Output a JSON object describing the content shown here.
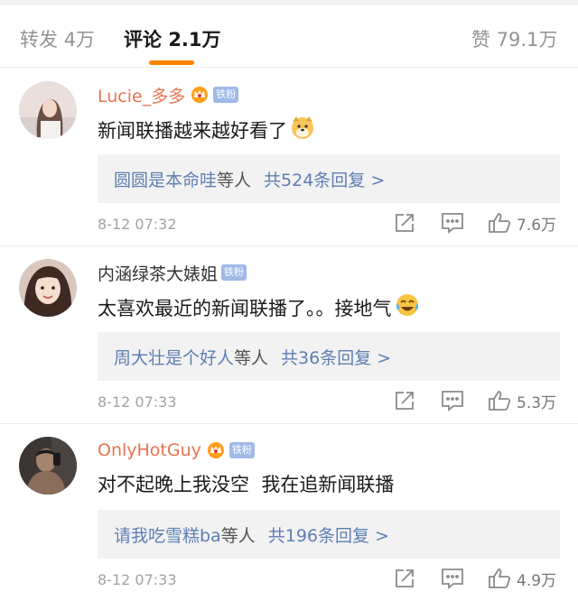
{
  "tabs": [
    {
      "label": "转发",
      "count": "4万"
    },
    {
      "label": "评论",
      "count": "2.1万"
    },
    {
      "label": "赞",
      "count": "79.1万"
    }
  ],
  "colors": {
    "accent": "#ff8200",
    "vip_name": "#eb7350",
    "link": "#5d7fb3"
  },
  "comments": [
    {
      "username": "Lucie_多多",
      "badge": "铁粉",
      "text": "新闻联播越来越好看了",
      "emoji": "doge-emoji-icon",
      "reply_user": "圆圆是本命哇",
      "reply_mid": "等人",
      "reply_count": "共524条回复 >",
      "time": "8-12 07:32",
      "likes": "7.6万"
    },
    {
      "username": "内涵绿茶大婊姐",
      "badge": "铁粉",
      "text": "太喜欢最近的新闻联播了。。接地气",
      "emoji": "laugh-cry-emoji-icon",
      "reply_user": "周大壮是个好人",
      "reply_mid": "等人",
      "reply_count": "共36条回复 >",
      "time": "8-12 07:33",
      "likes": "5.3万"
    },
    {
      "username": "OnlyHotGuy",
      "badge": "铁粉",
      "text": "对不起晚上我没空  我在追新闻联播",
      "emoji": "",
      "reply_user": "请我吃雪糕ba",
      "reply_mid": "等人",
      "reply_count": "共196条回复 >",
      "time": "8-12 07:33",
      "likes": "4.9万"
    }
  ]
}
